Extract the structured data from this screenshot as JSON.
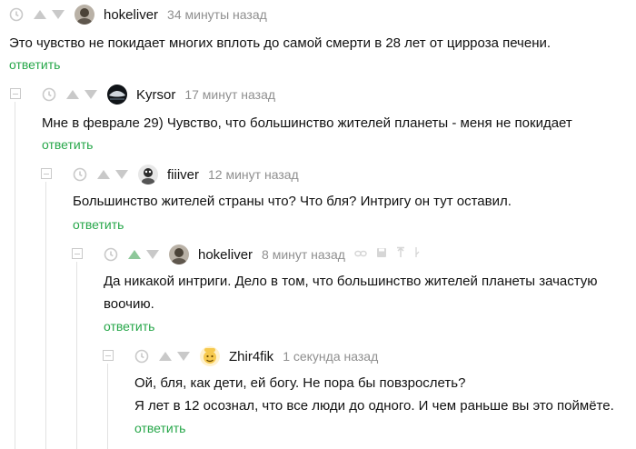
{
  "colors": {
    "accent": "#27a74a",
    "muted": "#8f8f8f",
    "icon": "#c9c9c9",
    "vote_up_active": "#8ec89a"
  },
  "comments": [
    {
      "user": "hokeliver",
      "time": "34 минуты назад",
      "lines": [
        "Это чувство не покидает многих вплоть до самой смерти в 28 лет от цирроза печени."
      ],
      "reply": "ответить"
    },
    {
      "user": "Kyrsor",
      "time": "17 минут назад",
      "lines": [
        "Мне в феврале 29) Чувство, что большинство жителей планеты - меня не покидает"
      ],
      "reply": "ответить"
    },
    {
      "user": "fiiiver",
      "time": "12 минут назад",
      "lines": [
        "Большинство жителей страны что? Что бля? Интригу он тут оставил."
      ],
      "reply": "ответить"
    },
    {
      "user": "hokeliver",
      "time": "8 минут назад",
      "lines": [
        "Да никакой интриги. Дело в том, что большинство жителей планеты зачастую",
        "воочию."
      ],
      "reply": "ответить"
    },
    {
      "user": "Zhir4fik",
      "time": "1 секунда назад",
      "lines": [
        "Ой, бля, как дети, ей богу. Не пора бы повзрослеть?",
        "Я лет в 12 осознал, что все люди до одного. И чем раньше вы это поймёте."
      ],
      "reply": "ответить"
    }
  ]
}
